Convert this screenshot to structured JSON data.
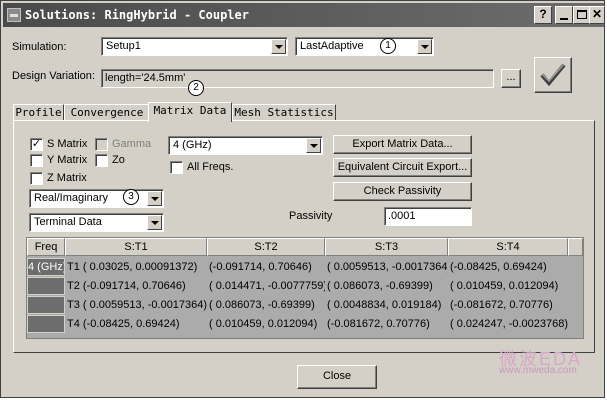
{
  "window": {
    "title": "Solutions: RingHybrid - Coupler"
  },
  "simulation": {
    "label": "Simulation:",
    "setup": "Setup1",
    "pass": "LastAdaptive",
    "marker": "1"
  },
  "design_variation": {
    "label": "Design Variation:",
    "value": "length='24.5mm'",
    "browse_label": "...",
    "marker": "2"
  },
  "tabs": [
    "Profile",
    "Convergence",
    "Matrix Data",
    "Mesh Statistics"
  ],
  "matrix_options": {
    "s_matrix": "S Matrix",
    "s_matrix_checked": true,
    "gamma": "Gamma",
    "gamma_checked": false,
    "y_matrix": "Y Matrix",
    "y_matrix_checked": false,
    "zo": "Zo",
    "zo_checked": false,
    "z_matrix": "Z Matrix",
    "z_matrix_checked": false,
    "format": "Real/Imaginary",
    "format_marker": "3",
    "data_type": "Terminal Data",
    "frequency": "4 (GHz)",
    "all_freqs": "All Freqs.",
    "all_freqs_checked": false
  },
  "buttons": {
    "export_matrix": "Export Matrix Data...",
    "equivalent_circuit": "Equivalent Circuit Export...",
    "check_passivity": "Check Passivity",
    "close": "Close"
  },
  "passivity": {
    "label": "Passivity",
    "value": ".0001"
  },
  "table": {
    "freq_header": "Freq",
    "columns": [
      "S:T1",
      "S:T2",
      "S:T3",
      "S:T4"
    ],
    "freq": "4 (GHz)",
    "rows": [
      {
        "label": "T1",
        "cells": [
          "( 0.03025, 0.00091372)",
          "(-0.091714, 0.70646)",
          "( 0.0059513, -0.0017364)",
          "(-0.08425, 0.69424)"
        ]
      },
      {
        "label": "T2",
        "cells": [
          "(-0.091714, 0.70646)",
          "( 0.014471, -0.0077759)",
          "( 0.086073, -0.69399)",
          "( 0.010459, 0.012094)"
        ]
      },
      {
        "label": "T3",
        "cells": [
          "( 0.0059513, -0.0017364)",
          "( 0.086073, -0.69399)",
          "( 0.0048834, 0.019184)",
          "(-0.081672, 0.70776)"
        ]
      },
      {
        "label": "T4",
        "cells": [
          "(-0.08425, 0.69424)",
          "( 0.010459, 0.012094)",
          "(-0.081672, 0.70776)",
          "( 0.024247, -0.0023768)"
        ]
      }
    ]
  },
  "watermark": {
    "text": "微波EDA",
    "url": "www.mweda.com"
  },
  "icons": {
    "title_controls": [
      "help-icon",
      "minimize-icon",
      "maximize-icon",
      "close-icon"
    ],
    "apply": "checkmark-icon"
  }
}
